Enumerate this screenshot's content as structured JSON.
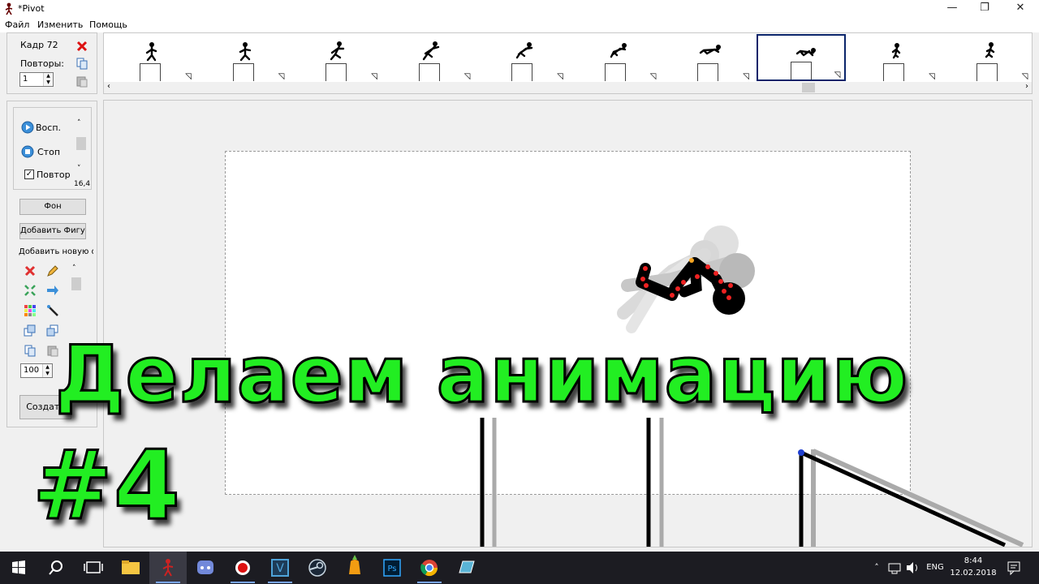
{
  "window": {
    "title": "*Pivot"
  },
  "menu": {
    "file": "Файл",
    "edit": "Изменить",
    "help": "Помощь"
  },
  "frame_panel": {
    "frame_label": "Кадр 72",
    "repeats_label": "Повторы:",
    "repeats_value": "1"
  },
  "playback": {
    "play": "Восп.",
    "stop": "Стоп",
    "loop": "Повтор",
    "loop_checked": true,
    "speed": "16,4"
  },
  "tools": {
    "background": "Фон",
    "add_figure": "Добавить Фигуру",
    "add_new": "Добавить новую ф",
    "size_value": "100",
    "create": "Создать"
  },
  "timeline": {
    "frame_count_visible": 10,
    "selected_index": 7
  },
  "overlay": {
    "line1": "Делаем анимацию",
    "line2": "#4",
    "color": "#22ee22"
  },
  "taskbar": {
    "lang": "ENG",
    "time": "8:44",
    "date": "12.02.2018"
  }
}
